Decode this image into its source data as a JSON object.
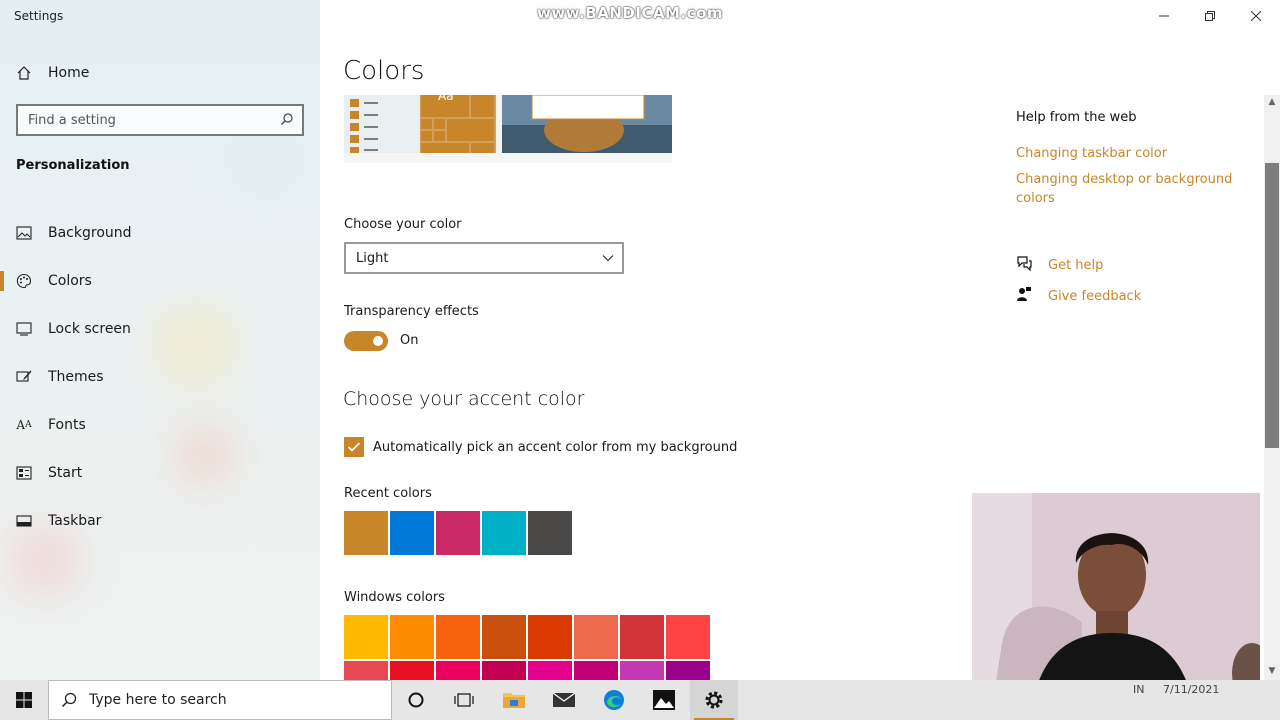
{
  "window": {
    "title": "Settings",
    "watermark": "www.BANDICAM.com"
  },
  "sidebar": {
    "home_label": "Home",
    "search_placeholder": "Find a setting",
    "section_label": "Personalization",
    "items": [
      {
        "label": "Background",
        "icon": "picture-icon"
      },
      {
        "label": "Colors",
        "icon": "palette-icon",
        "active": true
      },
      {
        "label": "Lock screen",
        "icon": "lock-screen-icon"
      },
      {
        "label": "Themes",
        "icon": "brush-icon"
      },
      {
        "label": "Fonts",
        "icon": "fonts-icon"
      },
      {
        "label": "Start",
        "icon": "start-icon"
      },
      {
        "label": "Taskbar",
        "icon": "taskbar-icon"
      }
    ]
  },
  "main": {
    "title": "Colors",
    "preview_tile_text": "Aa",
    "choose_color_label": "Choose your color",
    "choose_color_value": "Light",
    "transparency_label": "Transparency effects",
    "transparency_state": "On",
    "accent_heading": "Choose your accent color",
    "auto_accent_label": "Automatically pick an accent color from my background",
    "recent_colors_label": "Recent colors",
    "recent_colors": [
      "#c8862b",
      "#0078d7",
      "#c92a65",
      "#00b0c4",
      "#4a4948"
    ],
    "windows_colors_label": "Windows colors",
    "windows_colors_row1": [
      "#ffb900",
      "#ff8c00",
      "#f7630c",
      "#ca5010",
      "#da3b01",
      "#ef6950",
      "#d13438",
      "#ff4343"
    ],
    "windows_colors_row2": [
      "#e74856",
      "#e81123",
      "#ea005e",
      "#c30052",
      "#e3008c",
      "#bf0077",
      "#c239b3",
      "#9a0089"
    ]
  },
  "help": {
    "title": "Help from the web",
    "link1": "Changing taskbar color",
    "link2": "Changing desktop or background colors",
    "get_help": "Get help",
    "give_feedback": "Give feedback"
  },
  "taskbar": {
    "search_placeholder": "Type here to search",
    "tray_lang": "IN",
    "tray_date": "7/11/2021"
  },
  "colors": {
    "accent": "#c8862b"
  }
}
